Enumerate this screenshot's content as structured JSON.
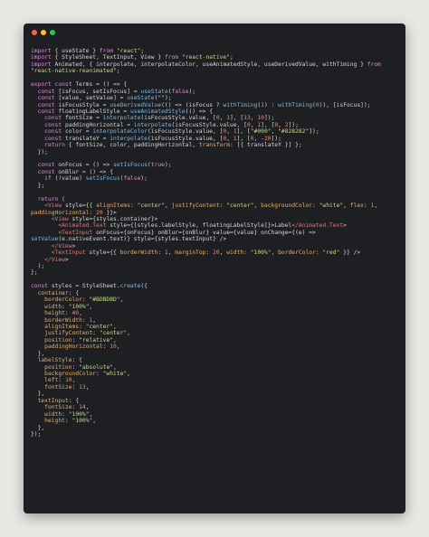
{
  "window": {
    "controls": [
      "close",
      "minimize",
      "maximize"
    ]
  },
  "colors": {
    "background": "#e8e7e3",
    "editor": "#1e1f22",
    "keyword": "#d98bd6",
    "string": "#c6d98a",
    "number": "#e58c72",
    "function": "#7fb8e8",
    "property": "#e3b06c",
    "plain": "#d6d6d6"
  },
  "code_lines": [
    "import { useState } from \"react\";",
    "import { StyleSheet, TextInput, View } from \"react-native\";",
    "import Animated, { interpolate, interpolateColor, useAnimatedStyle, useDerivedValue, withTiming } from",
    "\"react-native-reanimated\";",
    "",
    "export const Terms = () => {",
    "  const [isFocus, setIsFocus] = useState(false);",
    "  const [value, setValue] = useState(\"\");",
    "  const isFocusStyle = useDerivedValue(() => (isFocus ? withTiming(1) : withTiming(0)), [isFocus]);",
    "  const floatingLabelStyle = useAnimatedStyle(() => {",
    "    const fontSize = interpolate(isFocusStyle.value, [0, 1], [13, 10]);",
    "    const paddingHorizontal = interpolate(isFocusStyle.value, [0, 1], [0, 2]);",
    "    const color = interpolateColor(isFocusStyle.value, [0, 1], [\"#000\", \"#828282\"]);",
    "    const translateY = interpolate(isFocusStyle.value, [0, 1], [0, -20]);",
    "    return { fontSize, color, paddingHorizontal, transform: [{ translateY }] };",
    "  });",
    "",
    "  const onFocus = () => setIsFocus(true);",
    "  const onBlur = () => {",
    "    if (!value) setIsFocus(false);",
    "  };",
    "",
    "  return (",
    "    <View style={{ alignItems: \"center\", justifyContent: \"center\", backgroundColor: \"white\", flex: 1,",
    "paddingHorizontal: 20 }}>",
    "      <View style={styles.container}>",
    "        <Animated.Text style={[styles.labelStyle, floatingLabelStyle]}>Label</Animated.Text>",
    "        <TextInput onFocus={onFocus} onBlur={onBlur} value={value} onChange={(e) =>",
    "setValue(e.nativeEvent.text)} style={styles.textInput} />",
    "      </View>",
    "      <TextInput style={{ borderWidth: 1, marginTop: 20, width: \"100%\", borderColor: \"red\" }} />",
    "    </View>",
    "  );",
    "};",
    "",
    "const styles = StyleSheet.create({",
    "  container: {",
    "    borderColor: \"#BDBDBD\",",
    "    width: \"100%\",",
    "    height: 40,",
    "    borderWidth: 1,",
    "    alignItems: \"center\",",
    "    justifyContent: \"center\",",
    "    position: \"relative\",",
    "    paddingHorizontal: 10,",
    "  },",
    "  labelStyle: {",
    "    position: \"absolute\",",
    "    backgroundColor: \"white\",",
    "    left: 10,",
    "    fontSize: 13,",
    "  },",
    "  textInput: {",
    "    fontSize: 14,",
    "    width: \"100%\",",
    "    height: \"100%\",",
    "  },",
    "});"
  ]
}
